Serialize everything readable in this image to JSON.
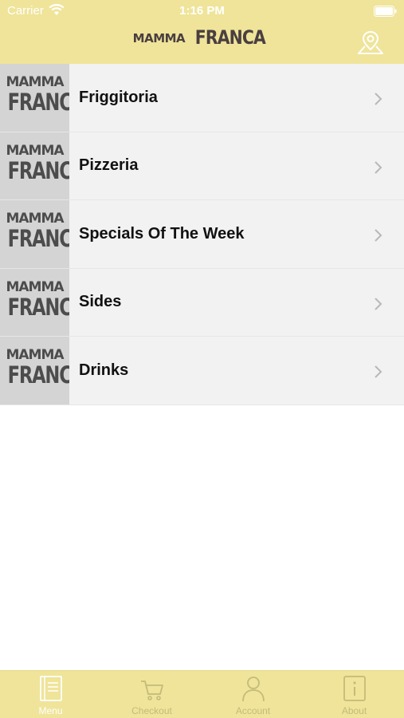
{
  "status_bar": {
    "carrier": "Carrier",
    "time": "1:16 PM"
  },
  "header": {
    "logo_small": "MAMMA",
    "logo_big": "FRANCA",
    "location_icon": "map-pin-icon"
  },
  "thumbnail_logo": {
    "small": "MAMMA",
    "big": "FRANCA"
  },
  "menu": {
    "items": [
      {
        "label": "Friggitoria"
      },
      {
        "label": "Pizzeria"
      },
      {
        "label": "Specials Of The Week"
      },
      {
        "label": "Sides"
      },
      {
        "label": "Drinks"
      }
    ]
  },
  "tab_bar": {
    "tabs": [
      {
        "label": "Menu",
        "icon": "book-icon",
        "active": true
      },
      {
        "label": "Checkout",
        "icon": "cart-icon",
        "active": false
      },
      {
        "label": "Account",
        "icon": "person-icon",
        "active": false
      },
      {
        "label": "About",
        "icon": "info-icon",
        "active": false
      }
    ]
  },
  "colors": {
    "bar_yellow": "#efe499",
    "thumb_gray": "#d4d4d4",
    "row_bg": "#f2f2f2",
    "logo_brown": "#4a3f40",
    "tab_inactive": "#c4bb7a"
  }
}
